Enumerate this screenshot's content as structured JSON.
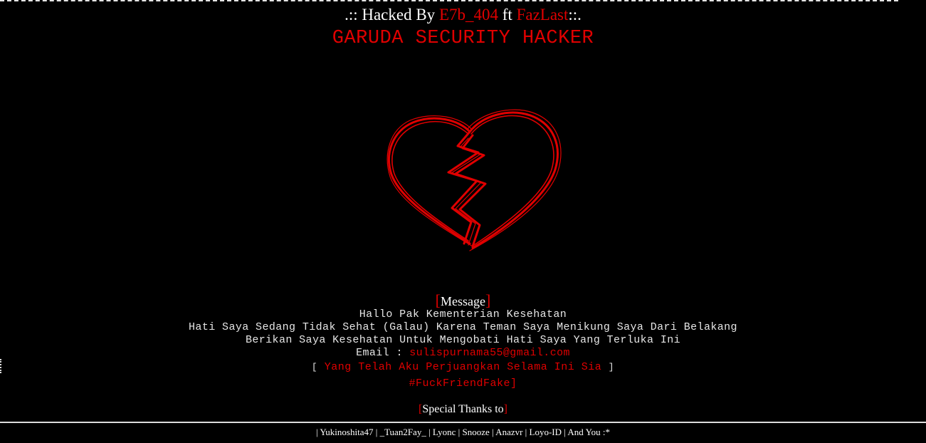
{
  "header": {
    "prefix": ".:: Hacked By ",
    "author1": "E7b_404",
    "joiner": " ft ",
    "author2": "FazLast",
    "suffix": "::.",
    "team": "GARUDA SECURITY HACKER"
  },
  "colors": {
    "background": "#000000",
    "accent": "#e00000",
    "text": "#ffffff"
  },
  "message": {
    "open_bracket": "[",
    "heading": "Message",
    "close_bracket": "]",
    "lines": [
      "Hallo Pak Kementerian Kesehatan",
      "Hati Saya Sedang Tidak Sehat (Galau) Karena Teman Saya Menikung Saya Dari Belakang",
      "Berikan Saya Kesehatan Untuk Mengobati Hati Saya Yang Terluka Ini"
    ],
    "email_label": "Email : ",
    "email": "sulispurnama55@gmail.com",
    "quote_open": "[",
    "quote": "Yang Telah Aku Perjuangkan Selama Ini Sia",
    "quote_close": "]",
    "hashtag": "#FuckFriendFake",
    "hashtag_close": "]"
  },
  "thanks": {
    "open_bracket": "[",
    "label": "Special Thanks to",
    "close_bracket": "]"
  },
  "credits": {
    "text": "| Yukinoshita47 | _Tuan2Fay_ | Lyonc | Snooze | Anazvr | Loyo-ID | And You :*"
  },
  "icons": {
    "heart": "broken-heart-icon"
  }
}
